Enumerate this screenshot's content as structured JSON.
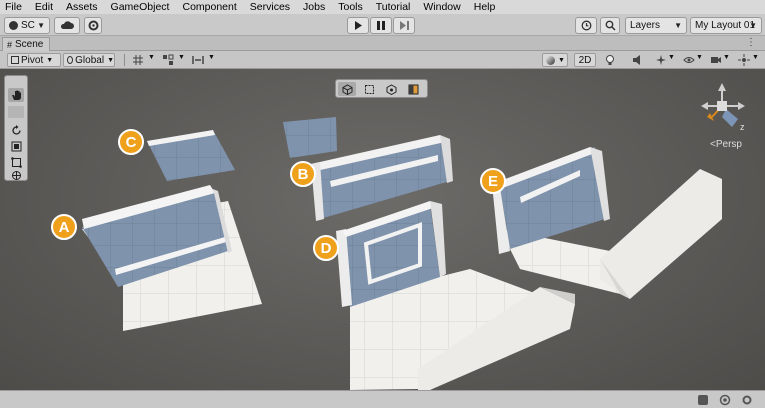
{
  "menu": [
    "File",
    "Edit",
    "Assets",
    "GameObject",
    "Component",
    "Services",
    "Jobs",
    "Tools",
    "Tutorial",
    "Window",
    "Help"
  ],
  "toolbar": {
    "account_label": "SC",
    "layers_label": "Layers",
    "layout_label": "My Layout 01"
  },
  "scene_tab": {
    "label": "Scene",
    "menu_glyph": "⋮"
  },
  "scene_toolbar": {
    "pivot_label": "Pivot",
    "global_label": "Global",
    "mode_2d_label": "2D"
  },
  "viewport": {
    "persp_label": "Persp",
    "gizmo_axis_label": "z",
    "markers": [
      {
        "label": "A",
        "color": "#f0a11c"
      },
      {
        "label": "B",
        "color": "#f0a11c"
      },
      {
        "label": "C",
        "color": "#f0a11c"
      },
      {
        "label": "D",
        "color": "#f0a11c"
      },
      {
        "label": "E",
        "color": "#f0a11c"
      }
    ]
  },
  "colors": {
    "wall_blue": "#7f93ad",
    "wall_white": "#ecebe8",
    "floor": "#f1f0ed",
    "marker": "#f0a11c",
    "viewport_bg": "#5e5c59"
  }
}
